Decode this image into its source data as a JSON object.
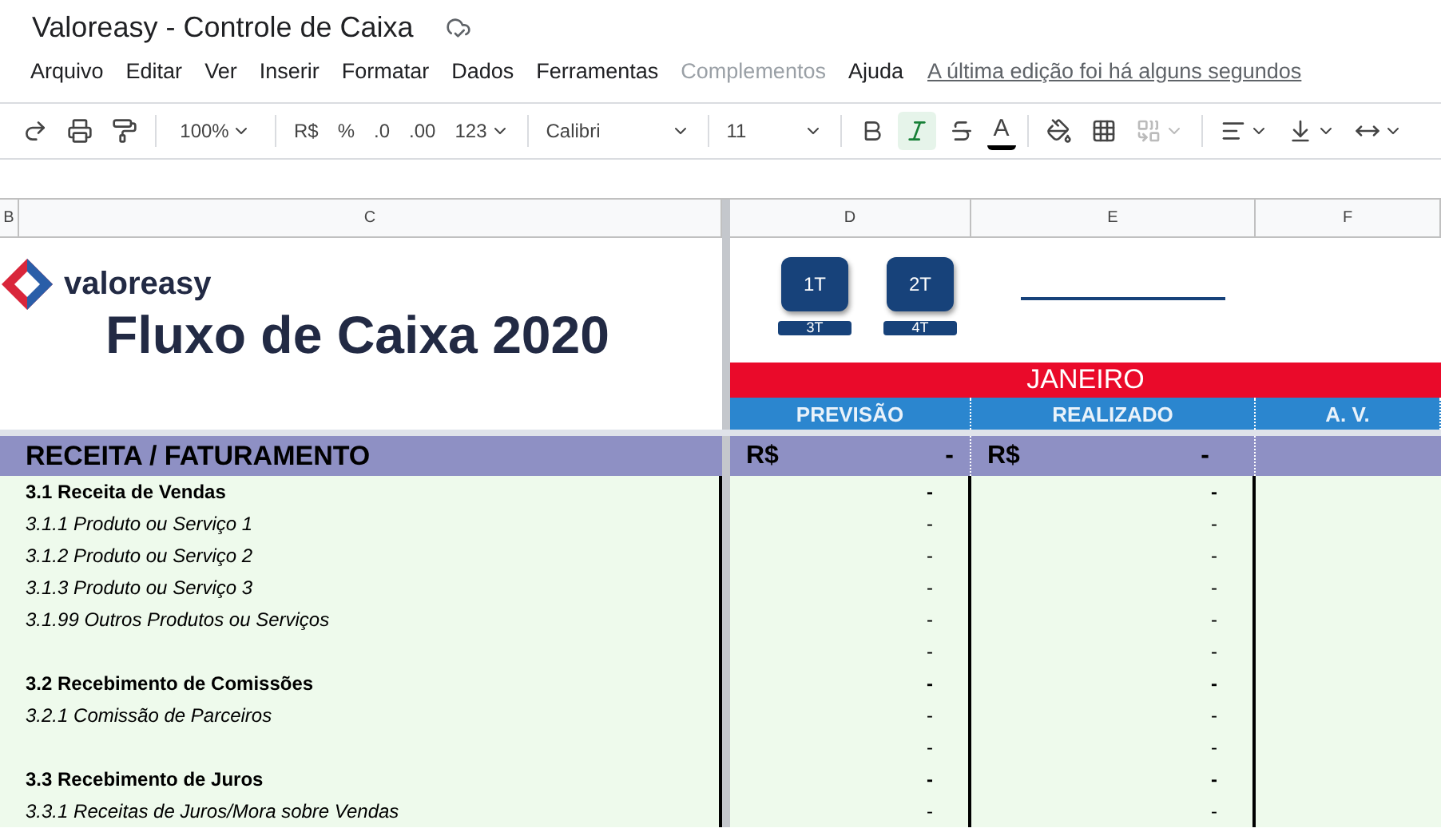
{
  "document": {
    "title": "Valoreasy - Controle de Caixa"
  },
  "menu": [
    {
      "label": "Arquivo",
      "disabled": false
    },
    {
      "label": "Editar",
      "disabled": false
    },
    {
      "label": "Ver",
      "disabled": false
    },
    {
      "label": "Inserir",
      "disabled": false
    },
    {
      "label": "Formatar",
      "disabled": false
    },
    {
      "label": "Dados",
      "disabled": false
    },
    {
      "label": "Ferramentas",
      "disabled": false
    },
    {
      "label": "Complementos",
      "disabled": true
    },
    {
      "label": "Ajuda",
      "disabled": false
    }
  ],
  "last_edit": "A última edição foi há alguns segundos",
  "toolbar": {
    "zoom": "100%",
    "currency": "R$",
    "percent": "%",
    "decrease_decimals": ".0",
    "increase_decimals": ".00",
    "number_format": "123",
    "font": "Calibri",
    "font_size": "11",
    "text_color_label": "A",
    "bold_on": false,
    "italic_on": true,
    "strike_on": false,
    "merge_disabled": true
  },
  "columns": [
    {
      "label": "B"
    },
    {
      "label": "C"
    },
    {
      "label": "D"
    },
    {
      "label": "E"
    },
    {
      "label": "F"
    }
  ],
  "header": {
    "brand": "valoreasy",
    "title": "Fluxo de Caixa 2020",
    "quarter_buttons": [
      "1T",
      "2T"
    ],
    "quarter_tabs": [
      "3T",
      "4T"
    ],
    "month": "JANEIRO",
    "subheaders": [
      "PREVISÃO",
      "REALIZADO",
      "A. V."
    ]
  },
  "section": {
    "label": "RECEITA / FATURAMENTO",
    "forecast_currency": "R$",
    "forecast_value": "-",
    "actual_currency": "R$",
    "actual_value": "-"
  },
  "rows": [
    {
      "kind": "group",
      "label": "3.1  Receita de Vendas",
      "forecast": "-",
      "actual": "-"
    },
    {
      "kind": "item",
      "label": "3.1.1 Produto ou Serviço 1",
      "forecast": "-",
      "actual": "-"
    },
    {
      "kind": "item",
      "label": "3.1.2 Produto ou Serviço 2",
      "forecast": "-",
      "actual": "-"
    },
    {
      "kind": "item",
      "label": "3.1.3 Produto ou Serviço 3",
      "forecast": "-",
      "actual": "-"
    },
    {
      "kind": "item",
      "label": "3.1.99 Outros Produtos ou Serviços",
      "forecast": "-",
      "actual": "-"
    },
    {
      "kind": "blank",
      "forecast": "-",
      "actual": "-"
    },
    {
      "kind": "group",
      "label": "3.2  Recebimento de Comissões",
      "forecast": "-",
      "actual": "-"
    },
    {
      "kind": "item",
      "label": "3.2.1 Comissão de Parceiros",
      "forecast": "-",
      "actual": "-"
    },
    {
      "kind": "blank",
      "forecast": "-",
      "actual": "-"
    },
    {
      "kind": "group",
      "label": "3.3  Recebimento de Juros",
      "forecast": "-",
      "actual": "-"
    },
    {
      "kind": "item",
      "label": "3.3.1  Receitas de Juros/Mora sobre Vendas",
      "forecast": "-",
      "actual": "-"
    }
  ]
}
